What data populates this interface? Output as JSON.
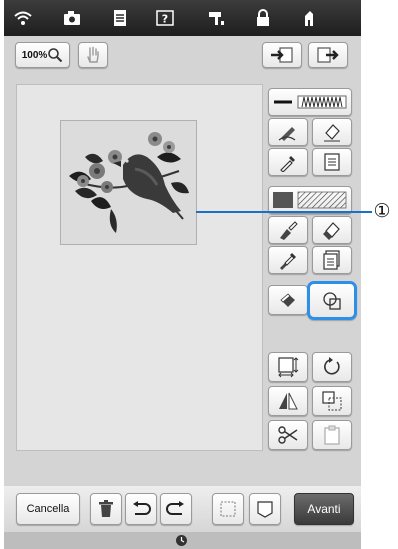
{
  "toolbar": {
    "zoom_label": "100%"
  },
  "icons": {
    "wifi": "wifi-icon",
    "camera": "camera-icon",
    "document": "document-icon",
    "help": "help-icon",
    "sewing": "sewing-mode-icon",
    "lock": "lock-icon",
    "home": "home-icon",
    "zoom": "magnifier-icon",
    "hand": "hand-icon",
    "import": "import-icon",
    "export": "export-icon"
  },
  "callout": {
    "marker": "①",
    "color": "#1a6fc9"
  },
  "bottom": {
    "cancel_label": "Cancella",
    "next_label": "Avanti"
  },
  "colors": {
    "highlight": "#2d8fe6",
    "top_bar": "#2a2a2a",
    "next_button": "#4a4a4a"
  }
}
